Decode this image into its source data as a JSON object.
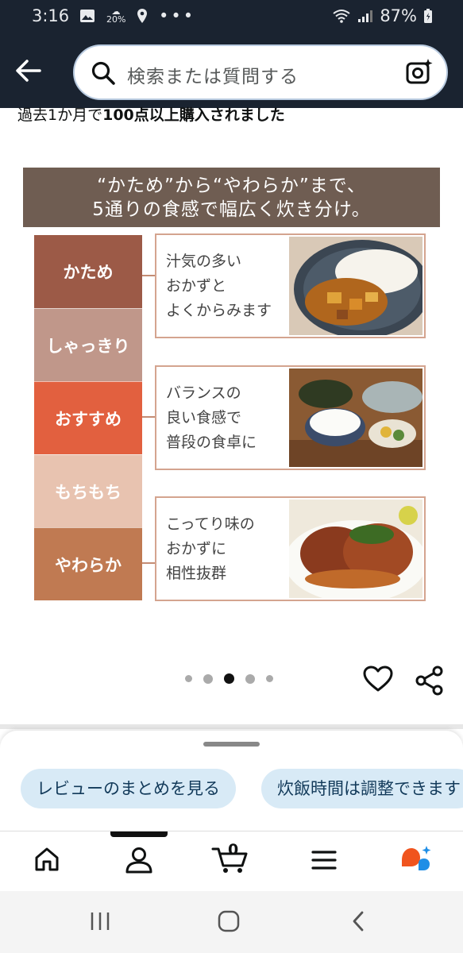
{
  "status_bar": {
    "time": "3:16",
    "weather_temp": "20%",
    "battery": "87%"
  },
  "header": {
    "search_placeholder": "検索または質問する"
  },
  "purchase_note": {
    "prefix": "過去1か月で",
    "bold": "100点以上購入されました"
  },
  "product_image": {
    "banner_line1": "“かため”から“やわらか”まで、",
    "banner_line2": "5通りの食感で幅広く炊き分け。",
    "levels": [
      "かため",
      "しゃっきり",
      "おすすめ",
      "もちもち",
      "やわらか"
    ],
    "level_colors": [
      "#9c5a47",
      "#c0978a",
      "#e2603f",
      "#e8c3b0",
      "#c07a52"
    ],
    "cards": [
      {
        "line1": "汁気の多い",
        "line2": "おかずと",
        "line3": "よくからみます",
        "image": "curry-rice-photo"
      },
      {
        "line1": "バランスの",
        "line2": "良い食感で",
        "line3": "普段の食卓に",
        "image": "japanese-meal-photo"
      },
      {
        "line1": "こってり味の",
        "line2": "おかずに",
        "line3": "相性抜群",
        "image": "hamburg-steak-photo"
      }
    ]
  },
  "carousel": {
    "count": 5,
    "active_index": 2
  },
  "bottom_sheet": {
    "chips": [
      "レビューのまとめを見る",
      "炊飯時間は調整できます"
    ]
  },
  "bottom_nav": {
    "cart_count": "0",
    "items": [
      "home-icon",
      "account-icon",
      "cart-icon",
      "menu-icon",
      "rufus-icon"
    ]
  },
  "colors": {
    "header_bg": "#1a2330",
    "chip_bg": "#d8eaf6",
    "accent_orange": "#f0541e",
    "accent_blue": "#1f8ee6"
  }
}
